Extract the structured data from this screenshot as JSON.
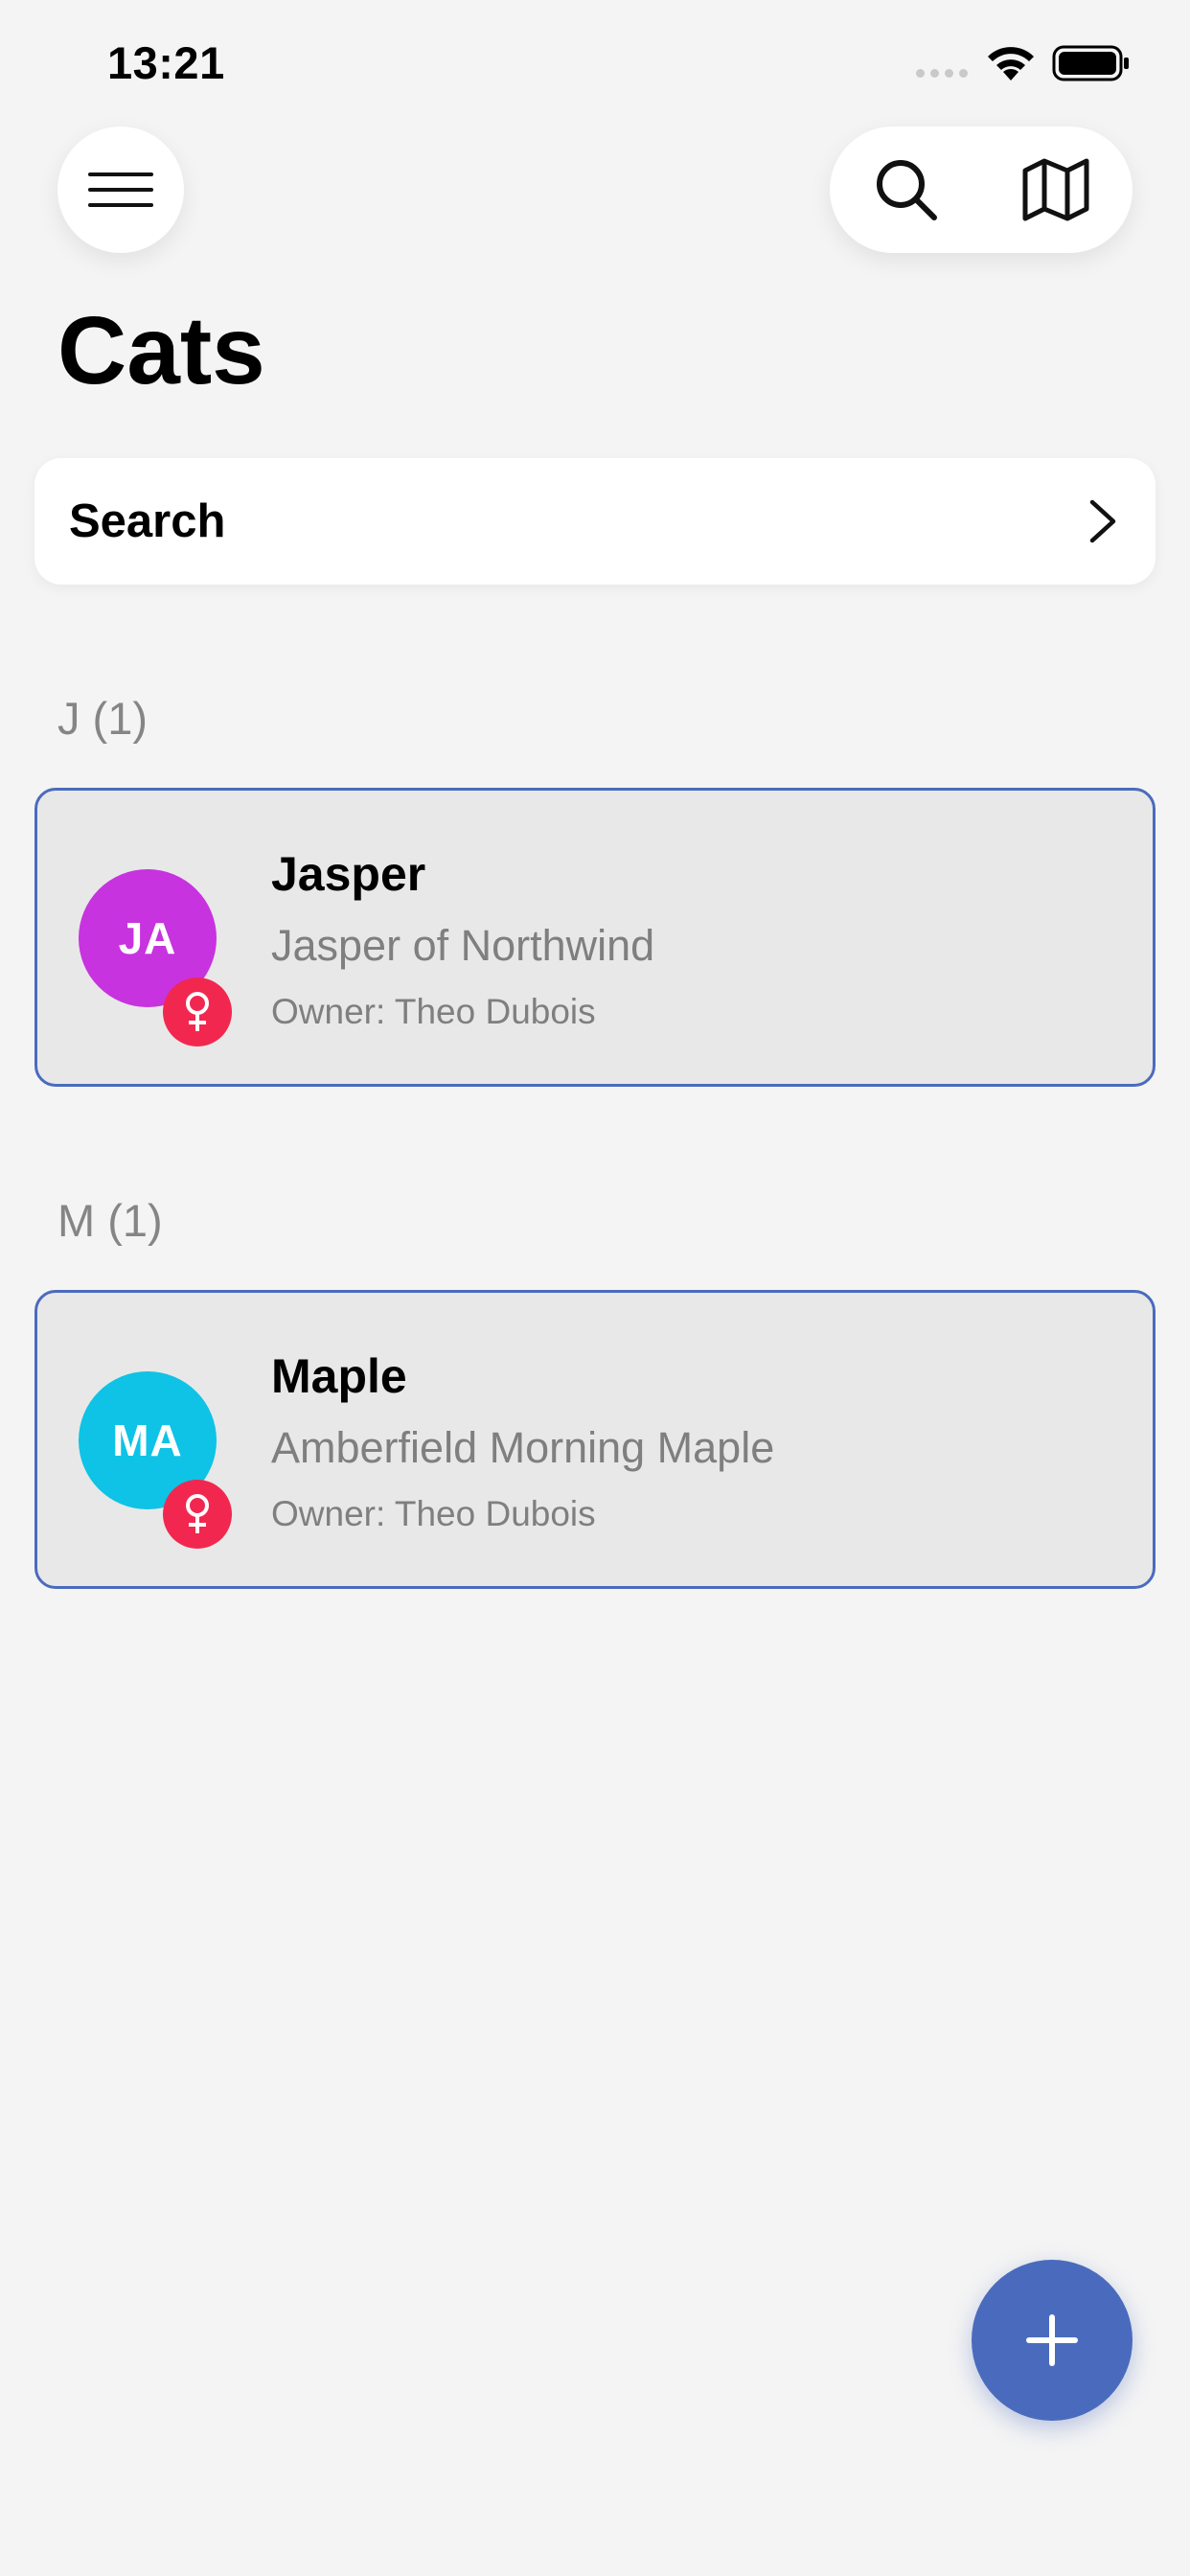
{
  "status_bar": {
    "time": "13:21"
  },
  "header": {
    "menu_icon": "hamburger-icon",
    "search_icon": "search-icon",
    "map_icon": "map-icon"
  },
  "page": {
    "title": "Cats"
  },
  "search": {
    "label": "Search",
    "chevron_icon": "chevron-right-icon"
  },
  "sections": [
    {
      "header": "J (1)",
      "cats": [
        {
          "initials": "JA",
          "avatar_color": "#c733df",
          "name": "Jasper",
          "full_name": "Jasper of Northwind",
          "owner": "Owner: Theo Dubois",
          "gender_icon": "female-icon"
        }
      ]
    },
    {
      "header": "M (1)",
      "cats": [
        {
          "initials": "MA",
          "avatar_color": "#0ec3e6",
          "name": "Maple",
          "full_name": "Amberfield Morning Maple",
          "owner": "Owner: Theo Dubois",
          "gender_icon": "female-icon"
        }
      ]
    }
  ],
  "fab": {
    "icon": "plus-icon"
  },
  "colors": {
    "accent": "#4a6bbd",
    "female_badge": "#f2274f",
    "background": "#f4f4f4"
  }
}
